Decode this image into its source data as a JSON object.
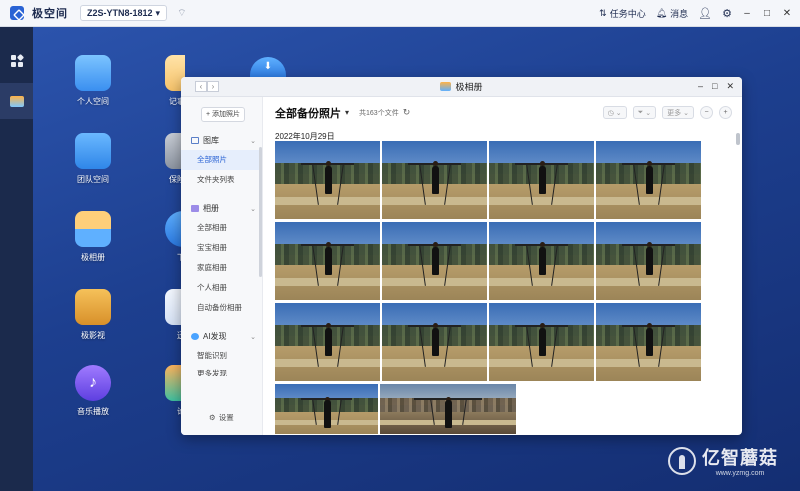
{
  "topbar": {
    "brand": "极空间",
    "device": "Z2S-YTN8-1812",
    "task_center": "任务中心",
    "messages": "消息"
  },
  "desktop": {
    "icons": [
      {
        "label": "个人空间",
        "color": "#4aa3ff"
      },
      {
        "label": "团队空间",
        "color": "#3f9cf0"
      },
      {
        "label": "极相册",
        "color": "#ffb347"
      },
      {
        "label": "极影视",
        "color": "#e8a33a"
      },
      {
        "label": "音乐播放",
        "color": "#7b5cf0"
      },
      {
        "label": "记事",
        "color": "#ffd27a"
      },
      {
        "label": "保险",
        "color": "#9aa3b0"
      },
      {
        "label": "下",
        "color": "#3a8ff0"
      },
      {
        "label": "迅",
        "color": "#e8eef8"
      },
      {
        "label": "论",
        "color": "#f0a040"
      }
    ]
  },
  "window": {
    "title": "极相册",
    "sidebar": {
      "add_photo": "+ 添加照片",
      "gallery": "图库",
      "all_photos": "全部照片",
      "folder_list": "文件夹列表",
      "albums": "相册",
      "album_items": [
        "全部相册",
        "宝宝相册",
        "家庭相册",
        "个人相册",
        "自动备份相册"
      ],
      "ai": "AI发现",
      "ai_items": [
        "智能识别",
        "更多发现"
      ],
      "settings": "设置"
    },
    "main": {
      "title": "全部备份照片",
      "count": "共163个文件",
      "more": "更多",
      "date": "2022年10月29日"
    }
  },
  "watermark": {
    "brand": "亿智蘑菇",
    "url": "www.yzmg.com"
  }
}
